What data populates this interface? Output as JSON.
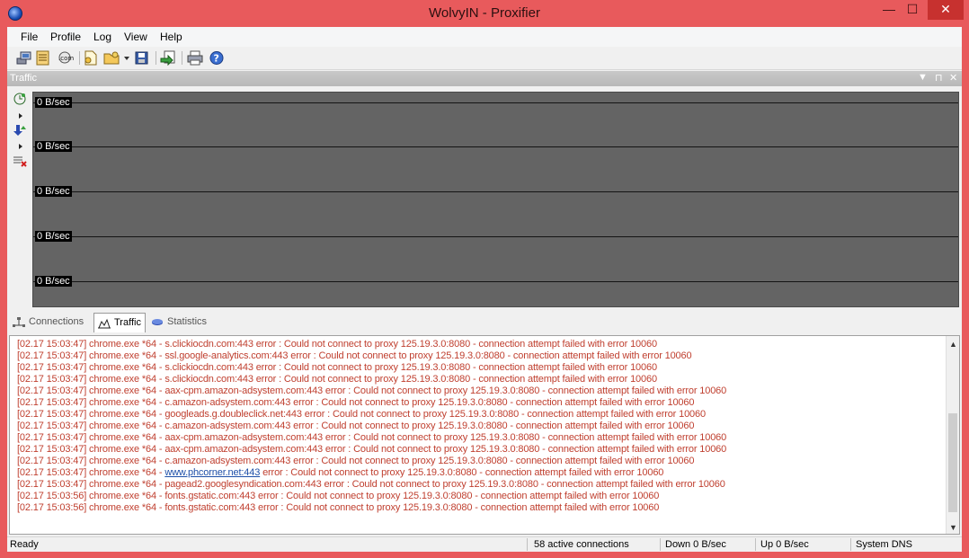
{
  "window": {
    "title": "WolvyIN - Proxifier",
    "minimize_glyph": "—",
    "maximize_glyph": "☐",
    "close_glyph": "✕"
  },
  "menu": {
    "file": "File",
    "profile": "Profile",
    "log": "Log",
    "view": "View",
    "help": "Help"
  },
  "toolbar": {
    "icons": [
      "network-icon",
      "proxy-list-icon",
      "rules-icon",
      "new-profile-icon",
      "open-profile-icon",
      "save-profile-icon",
      "export-icon",
      "print-icon",
      "help-icon"
    ]
  },
  "traffic_panel": {
    "title": "Traffic",
    "graph_labels": [
      "0 B/sec",
      "0 B/sec",
      "0 B/sec",
      "0 B/sec",
      "0 B/sec"
    ],
    "graph_bg": "#646464"
  },
  "tabs": [
    {
      "label": "Connections",
      "icon": "connections-icon",
      "active": false
    },
    {
      "label": "Traffic",
      "icon": "traffic-icon",
      "active": true
    },
    {
      "label": "Statistics",
      "icon": "statistics-icon",
      "active": false
    }
  ],
  "log": {
    "lines": [
      {
        "ts": "[02.17 15:03:47]",
        "proc": "chrome.exe *64 -",
        "host": "s.clickiocdn.com:443",
        "msg": "error : Could not connect to proxy 125.19.3.0:8080 - connection attempt failed with error 10060"
      },
      {
        "ts": "[02.17 15:03:47]",
        "proc": "chrome.exe *64 -",
        "host": "ssl.google-analytics.com:443",
        "msg": "error : Could not connect to proxy 125.19.3.0:8080 - connection attempt failed with error 10060"
      },
      {
        "ts": "[02.17 15:03:47]",
        "proc": "chrome.exe *64 -",
        "host": "s.clickiocdn.com:443",
        "msg": "error : Could not connect to proxy 125.19.3.0:8080 - connection attempt failed with error 10060"
      },
      {
        "ts": "[02.17 15:03:47]",
        "proc": "chrome.exe *64 -",
        "host": "s.clickiocdn.com:443",
        "msg": "error : Could not connect to proxy 125.19.3.0:8080 - connection attempt failed with error 10060"
      },
      {
        "ts": "[02.17 15:03:47]",
        "proc": "chrome.exe *64 -",
        "host": "aax-cpm.amazon-adsystem.com:443",
        "msg": "error : Could not connect to proxy 125.19.3.0:8080 - connection attempt failed with error 10060"
      },
      {
        "ts": "[02.17 15:03:47]",
        "proc": "chrome.exe *64 -",
        "host": "c.amazon-adsystem.com:443",
        "msg": "error : Could not connect to proxy 125.19.3.0:8080 - connection attempt failed with error 10060"
      },
      {
        "ts": "[02.17 15:03:47]",
        "proc": "chrome.exe *64 -",
        "host": "googleads.g.doubleclick.net:443",
        "msg": "error : Could not connect to proxy 125.19.3.0:8080 - connection attempt failed with error 10060"
      },
      {
        "ts": "[02.17 15:03:47]",
        "proc": "chrome.exe *64 -",
        "host": "c.amazon-adsystem.com:443",
        "msg": "error : Could not connect to proxy 125.19.3.0:8080 - connection attempt failed with error 10060"
      },
      {
        "ts": "[02.17 15:03:47]",
        "proc": "chrome.exe *64 -",
        "host": "aax-cpm.amazon-adsystem.com:443",
        "msg": "error : Could not connect to proxy 125.19.3.0:8080 - connection attempt failed with error 10060"
      },
      {
        "ts": "[02.17 15:03:47]",
        "proc": "chrome.exe *64 -",
        "host": "aax-cpm.amazon-adsystem.com:443",
        "msg": "error : Could not connect to proxy 125.19.3.0:8080 - connection attempt failed with error 10060"
      },
      {
        "ts": "[02.17 15:03:47]",
        "proc": "chrome.exe *64 -",
        "host": "c.amazon-adsystem.com:443",
        "msg": "error : Could not connect to proxy 125.19.3.0:8080 - connection attempt failed with error 10060"
      },
      {
        "ts": "[02.17 15:03:47]",
        "proc": "chrome.exe *64 -",
        "host": "www.phcorner.net:443",
        "link": true,
        "msg": "error : Could not connect to proxy 125.19.3.0:8080 - connection attempt failed with error 10060"
      },
      {
        "ts": "[02.17 15:03:47]",
        "proc": "chrome.exe *64 -",
        "host": "pagead2.googlesyndication.com:443",
        "msg": "error : Could not connect to proxy 125.19.3.0:8080 - connection attempt failed with error 10060"
      },
      {
        "ts": "[02.17 15:03:56]",
        "proc": "chrome.exe *64 -",
        "host": "fonts.gstatic.com:443",
        "msg": "error : Could not connect to proxy 125.19.3.0:8080 - connection attempt failed with error 10060"
      },
      {
        "ts": "[02.17 15:03:56]",
        "proc": "chrome.exe *64 -",
        "host": "fonts.gstatic.com:443",
        "msg": "error : Could not connect to proxy 125.19.3.0:8080 - connection attempt failed with error 10060"
      }
    ],
    "error_color": "#c04030",
    "link_color": "#1e4fa8"
  },
  "status": {
    "ready": "Ready",
    "connections": "58 active connections",
    "down": "Down 0 B/sec",
    "up": "Up 0 B/sec",
    "dns": "System DNS"
  },
  "colors": {
    "window_frame": "#e85a5c",
    "close_button": "#c7312f"
  }
}
